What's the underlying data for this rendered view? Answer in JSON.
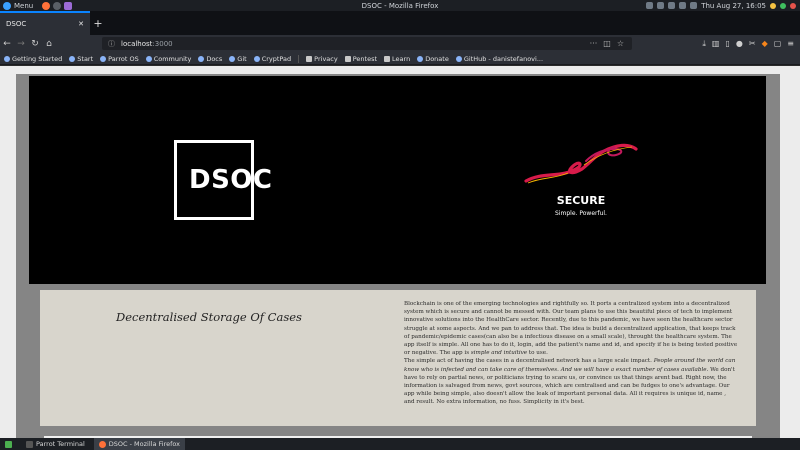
{
  "system_bar": {
    "menu_label": "Menu",
    "window_title": "DSOC - Mozilla Firefox",
    "clock": "Thu Aug 27, 16:05"
  },
  "browser": {
    "tab_title": "DSOC",
    "url_host": "localhost",
    "url_port": ":3000",
    "bookmarks": [
      "Getting Started",
      "Start",
      "Parrot OS",
      "Community",
      "Docs",
      "Git",
      "CryptPad",
      "Privacy",
      "Pentest",
      "Learn",
      "Donate",
      "GitHub - danistefanovi..."
    ]
  },
  "hero": {
    "logo_text": "DSOC",
    "secure_title": "SECURE",
    "secure_subtitle": "Simple. Powerful."
  },
  "card": {
    "title": "Decentralised Storage Of Cases",
    "p1": "Blockchain is one of the emerging technologies and rightfully so. It ports a centralized system into a decentralized system which is secure and cannot be messed with. Our team plans to use this beautiful piece of tech to implement innovative solutions into the HealthCare sector. Recently, due to this pandemic, we have seen the healthcare sector struggle at some aspects. And we pan to address that. The idea is build a decentralized application, that keeps track of pandemic/epidemic cases(can also be a infectious disease on a small scale), throught the healthcare system. The app itself is simple. All one has to do it, login, add the patient's name and id, and specify if he is being tested positive or negative. The app is ",
    "p1_em": "simple and intuitive",
    "p1_end": " to use.",
    "p2_start": "The simple act of having the cases in a decentralised network has a large scale impact. ",
    "p2_em": "People around the world can know who is infected and can take care of themselves. And we will have a exact number of cases available.",
    "p2_end": " We don't have to rely on partial news, or politicians trying to scare us, or convince us that things arent bad. Right now, the information is salvaged from news, govt sources, which are centralised and can be fudges to one's advantage. Our app while being simple, also doesn't allow the leak of important personal data. All it requires is unique id, name , and result. No extra information, no fuss. Simplicity in it's best."
  },
  "taskbar": {
    "items": [
      "Parrot Terminal",
      "DSOC - Mozilla Firefox"
    ]
  },
  "colors": {
    "accent": "#0a84ff",
    "hero_bg": "#000000",
    "card_bg": "#d8d5cc",
    "brush": "#d81b4a"
  }
}
